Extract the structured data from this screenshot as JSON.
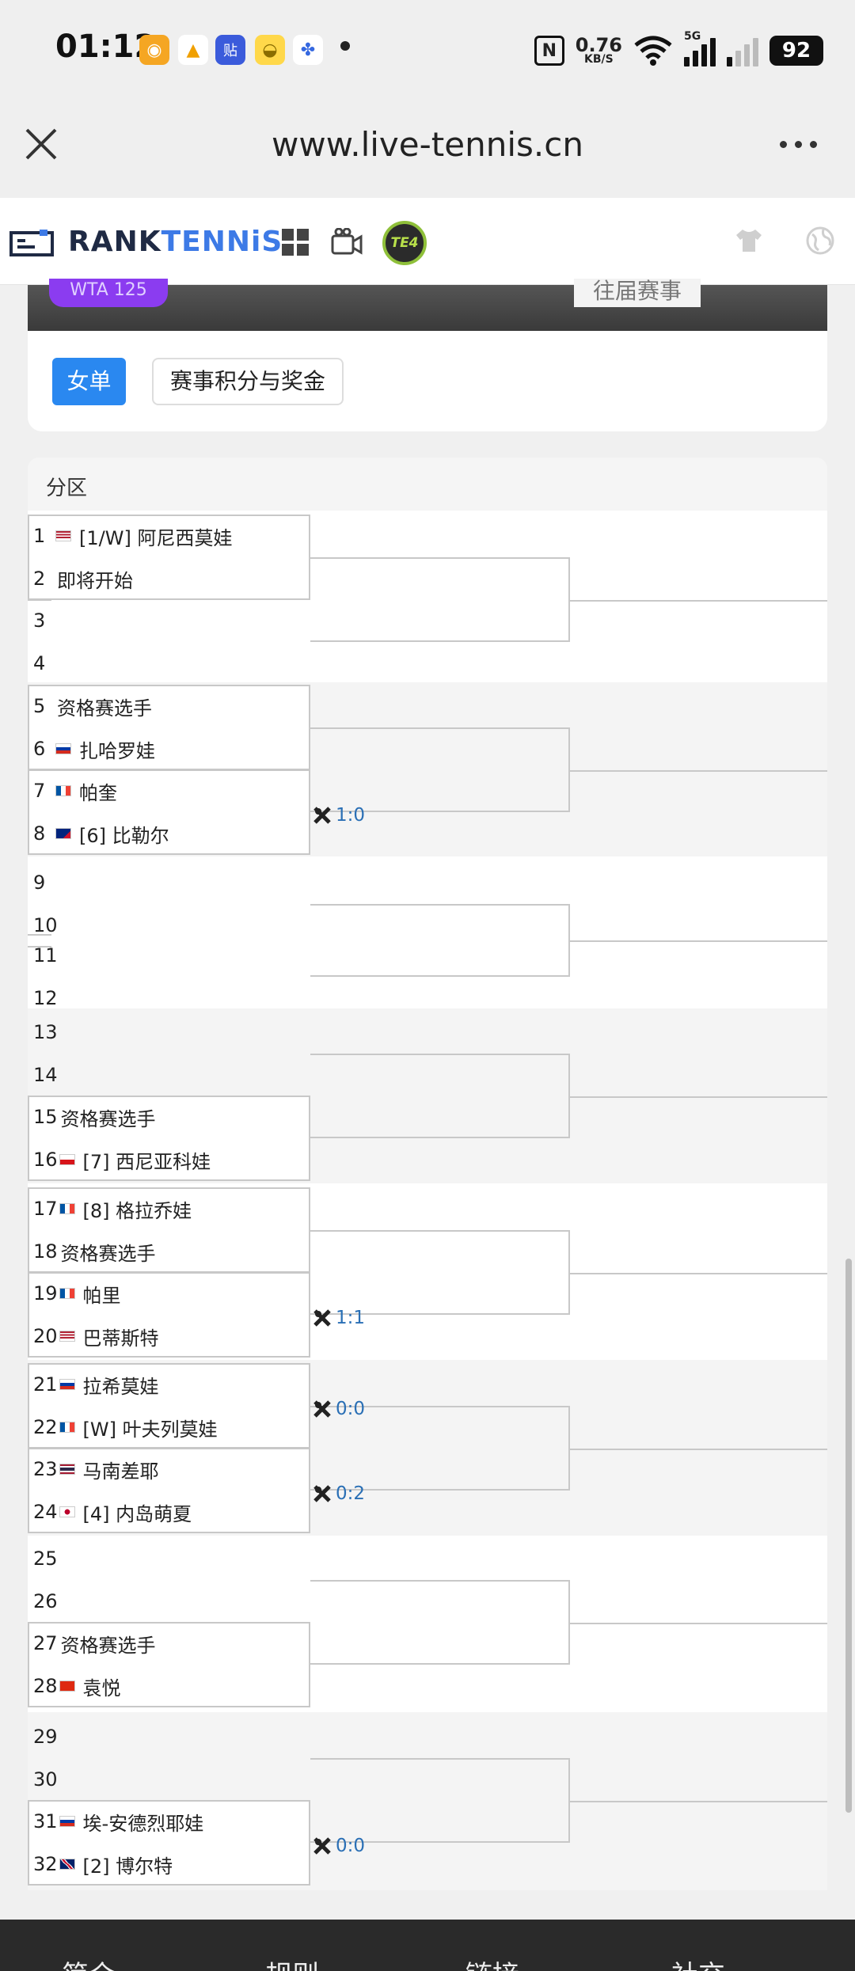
{
  "status_bar": {
    "time": "01:12",
    "speed_value": "0.76",
    "speed_unit": "KB/S",
    "network": "5G",
    "battery": "92"
  },
  "browser": {
    "url": "www.live-tennis.cn"
  },
  "site": {
    "logo_left": "RANK",
    "logo_right": "TENNiS",
    "te4_label": "TE4"
  },
  "event": {
    "badge": "WTA 125",
    "past_button": "往届赛事",
    "tabs": [
      {
        "label": "女单"
      },
      {
        "label": "赛事积分与奖金"
      }
    ]
  },
  "draw": {
    "section_title": "分区",
    "players": [
      {
        "num": "1",
        "flag": "us",
        "name": "[1/W] 阿尼西莫娃"
      },
      {
        "num": "2",
        "flag": "",
        "name": "即将开始"
      },
      {
        "num": "3",
        "flag": "",
        "name": ""
      },
      {
        "num": "4",
        "flag": "",
        "name": ""
      },
      {
        "num": "5",
        "flag": "",
        "name": "资格赛选手"
      },
      {
        "num": "6",
        "flag": "ru",
        "name": "扎哈罗娃"
      },
      {
        "num": "7",
        "flag": "fr",
        "name": "帕奎"
      },
      {
        "num": "8",
        "flag": "au",
        "name": "[6] 比勒尔"
      },
      {
        "num": "9",
        "flag": "",
        "name": ""
      },
      {
        "num": "10",
        "flag": "",
        "name": ""
      },
      {
        "num": "11",
        "flag": "",
        "name": ""
      },
      {
        "num": "12",
        "flag": "",
        "name": ""
      },
      {
        "num": "13",
        "flag": "",
        "name": ""
      },
      {
        "num": "14",
        "flag": "",
        "name": ""
      },
      {
        "num": "15",
        "flag": "",
        "name": "资格赛选手"
      },
      {
        "num": "16",
        "flag": "cz",
        "name": "[7] 西尼亚科娃"
      },
      {
        "num": "17",
        "flag": "fr",
        "name": "[8] 格拉乔娃"
      },
      {
        "num": "18",
        "flag": "",
        "name": "资格赛选手"
      },
      {
        "num": "19",
        "flag": "fr",
        "name": "帕里"
      },
      {
        "num": "20",
        "flag": "us",
        "name": "巴蒂斯特"
      },
      {
        "num": "21",
        "flag": "ru",
        "name": "拉希莫娃"
      },
      {
        "num": "22",
        "flag": "fr",
        "name": "[W] 叶夫列莫娃"
      },
      {
        "num": "23",
        "flag": "th",
        "name": "马南差耶"
      },
      {
        "num": "24",
        "flag": "jp",
        "name": "[4] 内岛萌夏"
      },
      {
        "num": "25",
        "flag": "",
        "name": ""
      },
      {
        "num": "26",
        "flag": "",
        "name": ""
      },
      {
        "num": "27",
        "flag": "",
        "name": "资格赛选手"
      },
      {
        "num": "28",
        "flag": "cn",
        "name": "袁悦"
      },
      {
        "num": "29",
        "flag": "",
        "name": ""
      },
      {
        "num": "30",
        "flag": "",
        "name": ""
      },
      {
        "num": "31",
        "flag": "ru",
        "name": "埃-安德烈耶娃"
      },
      {
        "num": "32",
        "flag": "gb",
        "name": "[2] 博尔特"
      }
    ],
    "scores": [
      {
        "match": "7-8",
        "text": "1:0"
      },
      {
        "match": "19-20",
        "text": "1:1"
      },
      {
        "match": "21-22",
        "text": "0:0"
      },
      {
        "match": "23-24",
        "text": "0:2"
      },
      {
        "match": "31-32",
        "text": "0:0"
      }
    ]
  },
  "bottom_nav": [
    {
      "label": "简介"
    },
    {
      "label": "规则"
    },
    {
      "label": "链接"
    },
    {
      "label": "社交"
    }
  ],
  "colors": {
    "accent": "#2a88f0",
    "score": "#2a6fb5",
    "badge": "#8b3cf0"
  }
}
